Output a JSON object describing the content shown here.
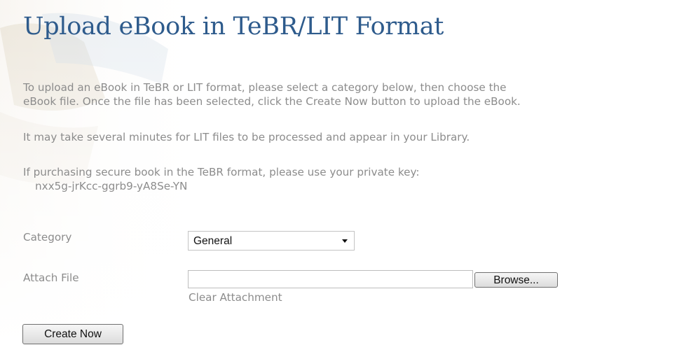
{
  "page": {
    "title": "Upload eBook in TeBR/LIT Format",
    "intro_line1": "To upload an eBook in TeBR or LIT format, please select a category below, then choose the",
    "intro_line2": "eBook file. Once the file has been selected, click the Create Now button to upload the eBook.",
    "note_line": "It may take several minutes for LIT files to be processed and appear in your Library.",
    "key_intro": "If purchasing secure book in the TeBR format, please use your private key:",
    "private_key": "nxx5g-jrKcc-ggrb9-yA8Se-YN"
  },
  "form": {
    "category_label": "Category",
    "category_value": "General",
    "attach_label": "Attach File",
    "file_value": "",
    "browse_label": "Browse...",
    "clear_label": "Clear Attachment",
    "create_label": "Create Now"
  },
  "icons": {
    "select_arrow": "chevron-down-icon"
  },
  "colors": {
    "title": "#2e5b8c",
    "body_text": "#8c8c8c"
  }
}
